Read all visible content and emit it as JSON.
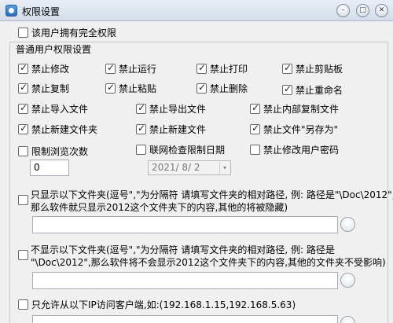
{
  "window": {
    "title": "权限设置",
    "min_label": "–",
    "max_label": "□",
    "close_label": "✕"
  },
  "full_permission": {
    "label": "该用户拥有完全权限",
    "checked": false
  },
  "group_title": "普通用户权限设置",
  "permissions": [
    {
      "label": "禁止修改",
      "checked": true
    },
    {
      "label": "禁止运行",
      "checked": true
    },
    {
      "label": "禁止打印",
      "checked": true
    },
    {
      "label": "禁止剪贴板",
      "checked": true
    },
    {
      "label": "禁止复制",
      "checked": true
    },
    {
      "label": "禁止粘贴",
      "checked": true
    },
    {
      "label": "禁止删除",
      "checked": true
    },
    {
      "label": "禁止重命名",
      "checked": true
    },
    {
      "label": "禁止导入文件",
      "checked": true
    },
    {
      "label": "禁止导出文件",
      "checked": true
    },
    {
      "label": "禁止内部复制文件",
      "checked": true
    },
    {
      "label": "禁止新建文件夹",
      "checked": true
    },
    {
      "label": "禁止新建文件",
      "checked": true
    },
    {
      "label": "禁止文件\"另存为\"",
      "checked": true
    }
  ],
  "browse_limit": {
    "label": "限制浏览次数",
    "checked": false,
    "value": "0"
  },
  "online_check": {
    "label": "联网检查限制日期",
    "checked": false,
    "date": "2021/ 8/ 2",
    "dropdown_icon": "▾"
  },
  "no_change_pwd": {
    "label": "禁止修改用户密码",
    "checked": false
  },
  "show_only": {
    "checked": false,
    "line1": "只显示以下文件夹(逗号\",\"为分隔符 请填写文件夹的相对路径, 例: 路径是\"\\Doc\\2012\",",
    "line2": "那么软件就只显示2012这个文件夹下的内容,其他的将被隐藏)",
    "value": ""
  },
  "hide_folders": {
    "checked": false,
    "line1": "不显示以下文件夹(逗号\",\"为分隔符 请填写文件夹的相对路径, 例: 路径是",
    "line2": "\"\\Doc\\2012\",那么软件将不会显示2012这个文件夹下的内容,其他的文件夹不受影响)",
    "value": ""
  },
  "ip_allow": {
    "checked": false,
    "label": "只允许从以下IP访问客户端,如:(192.168.1.15,192.168.5.63)",
    "value": ""
  }
}
